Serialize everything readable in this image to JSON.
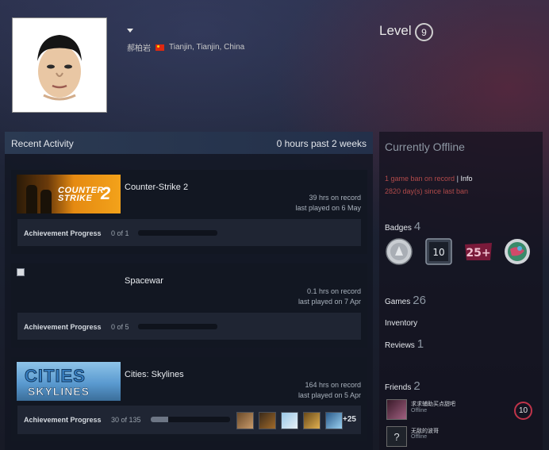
{
  "profile": {
    "real_name": "郝柏岩",
    "location": "Tianjin, Tianjin, China",
    "level_label": "Level",
    "level": "9"
  },
  "recent_activity": {
    "title": "Recent Activity",
    "hours_summary": "0 hours past 2 weeks",
    "games": [
      {
        "name": "Counter-Strike 2",
        "hours": "39 hrs on record",
        "last_played": "last played on 6 May",
        "achievement_label": "Achievement Progress",
        "achievement_count": "0 of 1",
        "progress": 0.0,
        "banner_text": [
          "COUNTER",
          "STRIKE",
          "2"
        ]
      },
      {
        "name": "Spacewar",
        "hours": "0.1 hrs on record",
        "last_played": "last played on 7 Apr",
        "achievement_label": "Achievement Progress",
        "achievement_count": "0 of 5",
        "progress": 0.0
      },
      {
        "name": "Cities: Skylines",
        "hours": "164 hrs on record",
        "last_played": "last played on 5 Apr",
        "achievement_label": "Achievement Progress",
        "achievement_count": "30 of 135",
        "progress": 0.22,
        "banner_text": [
          "CITIES",
          "SKYLINES"
        ],
        "more_achievements": "+25"
      }
    ]
  },
  "sidebar": {
    "status": "Currently Offline",
    "ban_text": "1 game ban on record",
    "ban_separator": "|",
    "ban_info_link": "Info",
    "ban_days": "2820 day(s) since last ban",
    "badges_label": "Badges",
    "badges_count": "4",
    "badge_items": [
      {
        "icon": "silver-coin-badge-icon"
      },
      {
        "icon": "years-of-service-badge-icon",
        "text": "10"
      },
      {
        "icon": "level-25-plus-badge-icon",
        "text": "25+"
      },
      {
        "icon": "colorful-planet-badge-icon"
      }
    ],
    "games_label": "Games",
    "games_count": "26",
    "inventory_label": "Inventory",
    "reviews_label": "Reviews",
    "reviews_count": "1",
    "friends_label": "Friends",
    "friends_count": "2",
    "friends": [
      {
        "name": "求求辅助买点甜吧",
        "status": "Offline",
        "level": "10"
      },
      {
        "name": "无敌的波哥",
        "status": "Offline",
        "avatar_text": "?"
      }
    ]
  },
  "colors": {
    "accent_red": "#b14a4a",
    "header_blue": "#2b3a52",
    "friend_level_ring": "#c0344a"
  }
}
